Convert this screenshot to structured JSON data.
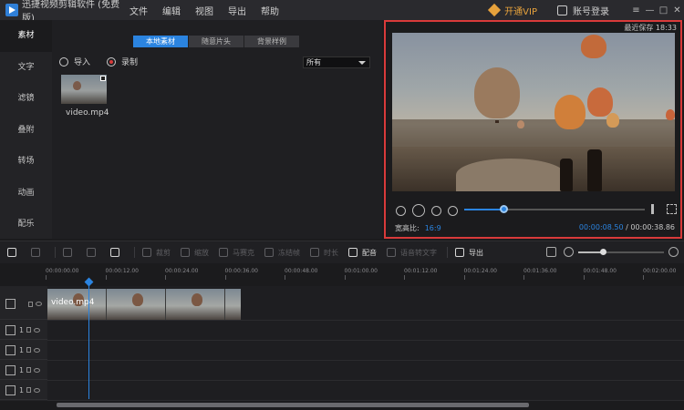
{
  "app": {
    "title": "迅捷视频剪辑软件 (免费版)",
    "brand_color": "#2b84e0"
  },
  "menu": [
    "文件",
    "编辑",
    "视图",
    "导出",
    "帮助"
  ],
  "titlebar": {
    "vip_label": "开通VIP",
    "account_label": "账号登录",
    "win_controls": [
      "≡",
      "—",
      "□",
      "✕"
    ]
  },
  "sidebar": {
    "items": [
      {
        "label": "素材",
        "active": true
      },
      {
        "label": "文字"
      },
      {
        "label": "滤镜"
      },
      {
        "label": "叠附"
      },
      {
        "label": "转场"
      },
      {
        "label": "动画"
      },
      {
        "label": "配乐"
      }
    ]
  },
  "media": {
    "tabs": [
      {
        "label": "本地素材",
        "active": true
      },
      {
        "label": "随意片头"
      },
      {
        "label": "背景样例"
      }
    ],
    "import_label": "导入",
    "record_label": "录制",
    "filter_value": "所有",
    "items": [
      {
        "label": "video.mp4"
      }
    ]
  },
  "preview": {
    "last_save": "最近保存 18:33",
    "aspect_label": "宽高比:",
    "aspect_value": "16:9",
    "current_time": "00:00:08.50",
    "total_time": "/ 00:00:38.86",
    "progress_fraction": 0.22
  },
  "toolbar": {
    "items": [
      {
        "label": "",
        "icon": "undo-icon",
        "enabled": true
      },
      {
        "label": "",
        "icon": "redo-icon",
        "enabled": false
      },
      {
        "label": "",
        "icon": "edit-icon",
        "enabled": false
      },
      {
        "label": "",
        "icon": "split-icon",
        "enabled": false
      },
      {
        "label": "",
        "icon": "trash-icon",
        "enabled": true
      },
      {
        "label": "裁剪",
        "icon": "crop-icon",
        "enabled": false
      },
      {
        "label": "缩放",
        "icon": "zoom-icon",
        "enabled": false
      },
      {
        "label": "马赛克",
        "icon": "mosaic-icon",
        "enabled": false
      },
      {
        "label": "冻结帧",
        "icon": "freeze-icon",
        "enabled": false
      },
      {
        "label": "时长",
        "icon": "duration-icon",
        "enabled": false
      },
      {
        "label": "配音",
        "icon": "mic-icon",
        "enabled": true
      },
      {
        "label": "语音转文字",
        "icon": "speech-icon",
        "enabled": false
      },
      {
        "label": "导出",
        "icon": "export-icon",
        "enabled": true
      }
    ],
    "zoom_fraction": 0.3
  },
  "timeline": {
    "ruler": [
      "00:00:00.00",
      "00:00:12.00",
      "00:00:24.00",
      "00:00:36.00",
      "00:00:48.00",
      "00:01:00.00",
      "00:01:12.00",
      "00:01:24.00",
      "00:01:36.00",
      "00:01:48.00",
      "00:02:00.00"
    ],
    "clip_label": "video.mp4",
    "tracks": [
      {
        "icon": "video-track-icon",
        "num": ""
      },
      {
        "icon": "film-track-icon",
        "num": "1"
      },
      {
        "icon": "text-track-icon",
        "num": "1"
      },
      {
        "icon": "music-track-icon",
        "num": "1"
      },
      {
        "icon": "voice-track-icon",
        "num": "1"
      }
    ]
  }
}
